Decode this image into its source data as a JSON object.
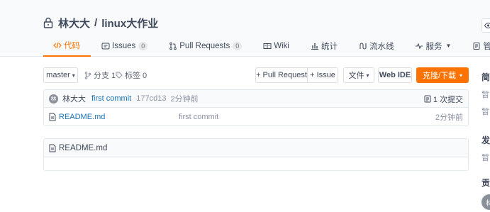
{
  "repo": {
    "owner": "林大大",
    "separator": "/",
    "name": "linux大作业"
  },
  "tabs": [
    {
      "label": "代码",
      "icon": "code-icon",
      "active": true
    },
    {
      "label": "Issues",
      "icon": "issues-icon",
      "count": "0"
    },
    {
      "label": "Pull Requests",
      "icon": "pull-request-icon",
      "count": "0"
    },
    {
      "label": "Wiki",
      "icon": "wiki-icon"
    },
    {
      "label": "统计",
      "icon": "stats-icon"
    },
    {
      "label": "流水线",
      "icon": "pipeline-icon"
    },
    {
      "label": "服务",
      "icon": "service-icon",
      "caret": "▼"
    },
    {
      "label": "管理",
      "icon": "manage-icon"
    }
  ],
  "toolbar": {
    "branch": "master",
    "branch_caret": "▾",
    "branches": "分支 1",
    "tags": "标签 0",
    "pull_request": "+ Pull Request",
    "issue": "+ Issue",
    "file": "文件",
    "file_caret": "▾",
    "web_ide": "Web IDE",
    "clone": "克隆/下载",
    "clone_caret": "▾"
  },
  "commit": {
    "avatar_initial": "林",
    "author": "林大大",
    "message": "first commit",
    "sha": "177cd13",
    "time": "2分钟前",
    "count": "1 次提交"
  },
  "files": [
    {
      "name": "README.md",
      "message": "first commit",
      "time": "2分钟前"
    }
  ],
  "readme": {
    "title": "README.md"
  },
  "sidebar": {
    "intro_heading": "简",
    "intro_text_1": "暂",
    "intro_text_2": "暂",
    "release_heading": "发",
    "release_text": "暂",
    "contrib_heading": "贡",
    "contrib_avatar": "林"
  },
  "colors": {
    "accent": "#fe7300",
    "link": "#1a73b5",
    "muted": "#8c92a4",
    "header_bg": "#f8fafc"
  }
}
